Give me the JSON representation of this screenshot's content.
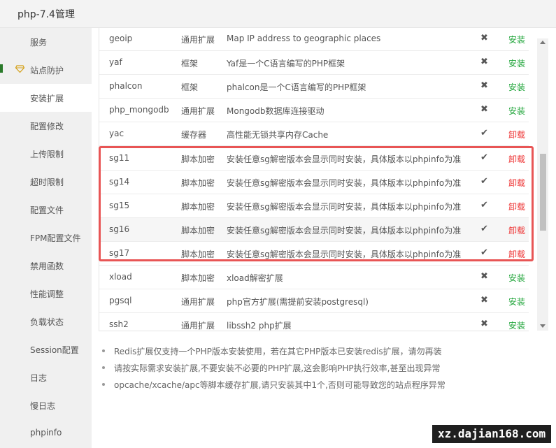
{
  "window": {
    "title": "php-7.4管理"
  },
  "sidebar": {
    "items": [
      {
        "label": "服务"
      },
      {
        "label": "站点防护"
      },
      {
        "label": "安装扩展"
      },
      {
        "label": "配置修改"
      },
      {
        "label": "上传限制"
      },
      {
        "label": "超时限制"
      },
      {
        "label": "配置文件"
      },
      {
        "label": "FPM配置文件"
      },
      {
        "label": "禁用函数"
      },
      {
        "label": "性能调整"
      },
      {
        "label": "负载状态"
      },
      {
        "label": "Session配置"
      },
      {
        "label": "日志"
      },
      {
        "label": "慢日志"
      },
      {
        "label": "phpinfo"
      }
    ],
    "active": "安装扩展"
  },
  "extensions": {
    "rows": [
      {
        "name": "geoip",
        "type": "通用扩展",
        "desc": "Map IP address to geographic places",
        "status": "✖",
        "action": "安装"
      },
      {
        "name": "yaf",
        "type": "框架",
        "desc": "Yaf是一个C语言编写的PHP框架",
        "status": "✖",
        "action": "安装"
      },
      {
        "name": "phalcon",
        "type": "框架",
        "desc": "phalcon是一个C语言编写的PHP框架",
        "status": "✖",
        "action": "安装"
      },
      {
        "name": "php_mongodb",
        "type": "通用扩展",
        "desc": "Mongodb数据库连接驱动",
        "status": "✖",
        "action": "安装"
      },
      {
        "name": "yac",
        "type": "缓存器",
        "desc": "高性能无锁共享内存Cache",
        "status": "✔",
        "action": "卸载"
      },
      {
        "name": "sg11",
        "type": "脚本加密",
        "desc": "安装任意sg解密版本会显示同时安装，具体版本以phpinfo为准",
        "status": "✔",
        "action": "卸载"
      },
      {
        "name": "sg14",
        "type": "脚本加密",
        "desc": "安装任意sg解密版本会显示同时安装，具体版本以phpinfo为准",
        "status": "✔",
        "action": "卸载"
      },
      {
        "name": "sg15",
        "type": "脚本加密",
        "desc": "安装任意sg解密版本会显示同时安装，具体版本以phpinfo为准",
        "status": "✔",
        "action": "卸载"
      },
      {
        "name": "sg16",
        "type": "脚本加密",
        "desc": "安装任意sg解密版本会显示同时安装，具体版本以phpinfo为准",
        "status": "✔",
        "action": "卸载"
      },
      {
        "name": "sg17",
        "type": "脚本加密",
        "desc": "安装任意sg解密版本会显示同时安装，具体版本以phpinfo为准",
        "status": "✔",
        "action": "卸载"
      },
      {
        "name": "xload",
        "type": "脚本加密",
        "desc": "xload解密扩展",
        "status": "✖",
        "action": "安装"
      },
      {
        "name": "pgsql",
        "type": "通用扩展",
        "desc": "php官方扩展(需提前安装postgresql)",
        "status": "✖",
        "action": "安装"
      },
      {
        "name": "ssh2",
        "type": "通用扩展",
        "desc": "libssh2 php扩展",
        "status": "✖",
        "action": "安装"
      }
    ]
  },
  "notes": [
    "Redis扩展仅支持一个PHP版本安装使用，若在其它PHP版本已安装redis扩展，请勿再装",
    "请按实际需求安装扩展,不要安装不必要的PHP扩展,这会影响PHP执行效率,甚至出现异常",
    "opcache/xcache/apc等脚本缓存扩展,请只安装其中1个,否则可能导致您的站点程序异常"
  ],
  "watermark": "xz.dajian168.com",
  "colors": {
    "install": "#20a53a",
    "uninstall": "#ee3333",
    "highlight": "#e85555"
  }
}
